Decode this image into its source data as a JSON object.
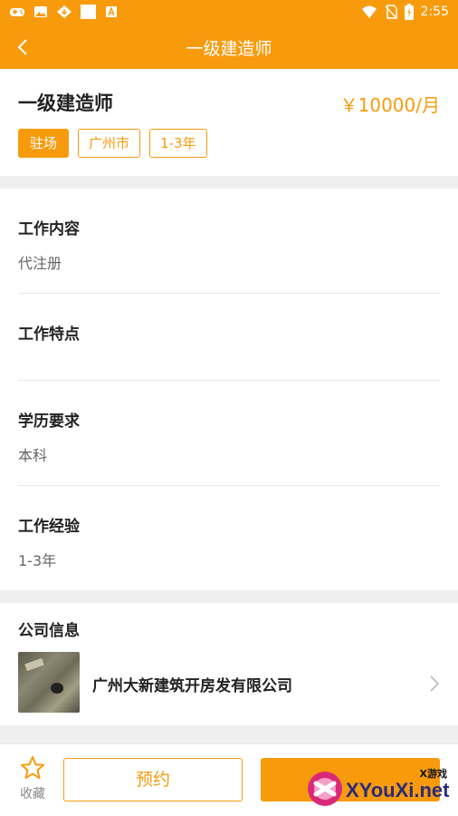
{
  "status_bar": {
    "time": "2:55"
  },
  "app_bar": {
    "title": "一级建造师"
  },
  "job": {
    "title": "一级建造师",
    "salary": "￥10000/月",
    "tags": [
      "驻场",
      "广州市",
      "1-3年"
    ]
  },
  "details": [
    {
      "label": "工作内容",
      "value": "代注册"
    },
    {
      "label": "工作特点",
      "value": ""
    },
    {
      "label": "学历要求",
      "value": "本科"
    },
    {
      "label": "工作经验",
      "value": "1-3年"
    }
  ],
  "company": {
    "section_title": "公司信息",
    "name": "广州大新建筑开房发有限公司"
  },
  "bottom_bar": {
    "favorite_label": "收藏",
    "reserve_label": "预约",
    "primary_label": ""
  },
  "watermark": {
    "cn": "X游戏",
    "en": "XYouXi.net"
  },
  "colors": {
    "accent": "#f79b0d",
    "text": "#222222",
    "muted": "#666666"
  },
  "icons": [
    "gamepad-icon",
    "image-icon",
    "download-icon",
    "square-icon",
    "font-icon",
    "wifi-icon",
    "no-sim-icon",
    "battery-icon",
    "back-arrow-icon",
    "chevron-right-icon",
    "star-icon"
  ]
}
